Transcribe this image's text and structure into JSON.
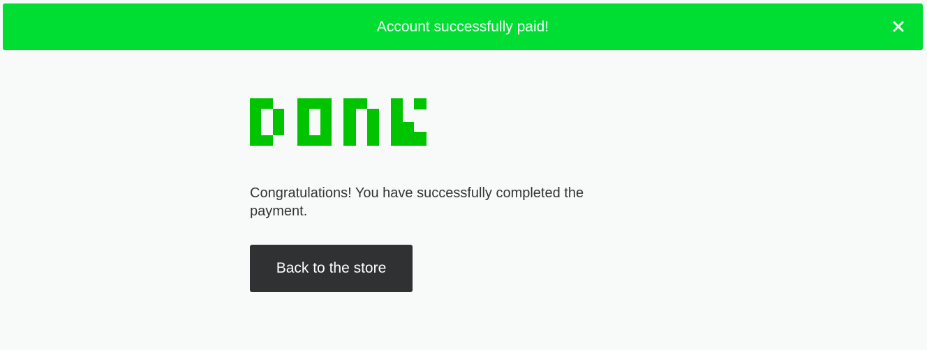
{
  "banner": {
    "message": "Account successfully paid!",
    "close_icon": "close-icon",
    "background_color": "#00dd33"
  },
  "logo": {
    "icon": "done-pixel-logo",
    "text": "DONE",
    "color": "#00c400"
  },
  "content": {
    "message": "Congratulations! You have successfully completed the payment."
  },
  "actions": {
    "back_label": "Back to the store",
    "back_color": "#2f3133"
  }
}
